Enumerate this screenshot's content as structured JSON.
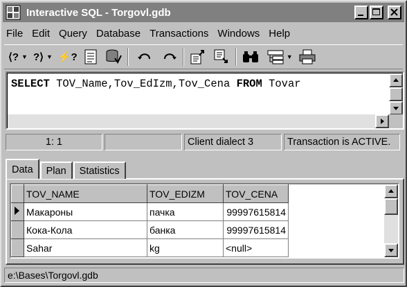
{
  "window": {
    "title": "Interactive SQL - Torgovl.gdb"
  },
  "menu": [
    "File",
    "Edit",
    "Query",
    "Database",
    "Transactions",
    "Windows",
    "Help"
  ],
  "toolbar": {
    "prev_query_label": "⟨?",
    "next_query_label": "?⟩",
    "execute_label": "⚡?",
    "icons": [
      "previous-query-icon",
      "next-query-icon",
      "execute-query-icon",
      "script-icon",
      "commit-icon",
      "undo-icon",
      "redo-icon",
      "load-script-icon",
      "save-script-icon",
      "find-icon",
      "layout-icon",
      "print-icon"
    ]
  },
  "editor": {
    "sql_parts": [
      {
        "text": "SELECT",
        "kw": true
      },
      {
        "text": " TOV_Name,Tov_EdIzm,Tov_Cena ",
        "kw": false
      },
      {
        "text": "FROM",
        "kw": true
      },
      {
        "text": " Tovar",
        "kw": false
      }
    ]
  },
  "status": {
    "position": "1:  1",
    "empty": "",
    "dialect": "Client dialect 3",
    "transaction": "Transaction is ACTIVE."
  },
  "tabs": [
    "Data",
    "Plan",
    "Statistics"
  ],
  "grid": {
    "columns": [
      "TOV_NAME",
      "TOV_EDIZM",
      "TOV_CENA"
    ],
    "rows": [
      [
        "Макароны",
        "пачка",
        "99997615814"
      ],
      [
        "Кока-Кола",
        "банка",
        "99997615814"
      ],
      [
        "Sahar",
        "kg",
        "<null>"
      ]
    ]
  },
  "bottom_status": "e:\\Bases\\Torgovl.gdb",
  "colors": {
    "titlebar": "#808080",
    "face": "#c0c0c0"
  }
}
